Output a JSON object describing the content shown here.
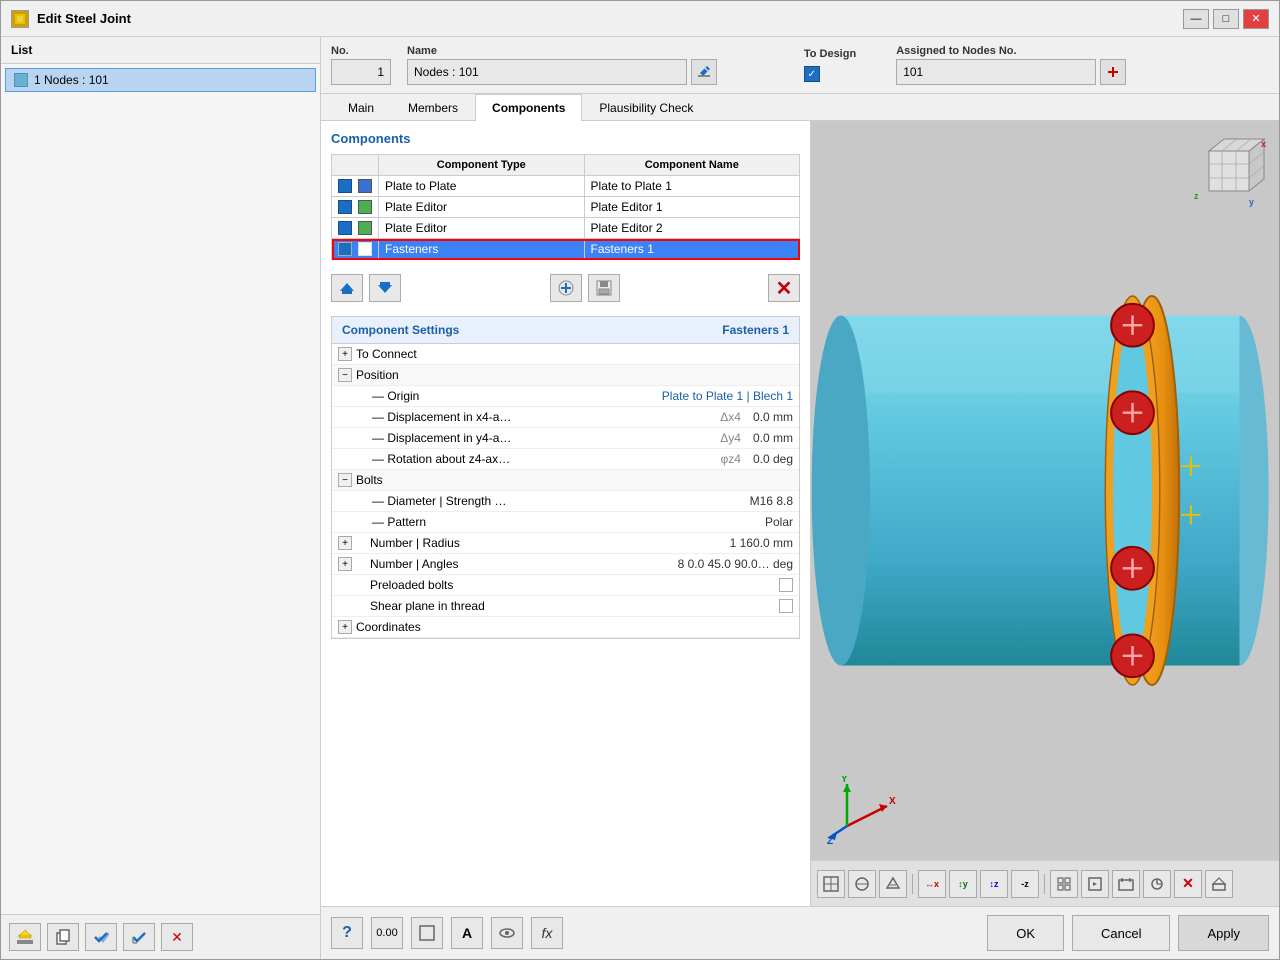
{
  "window": {
    "title": "Edit Steel Joint",
    "icon": "🔧"
  },
  "header": {
    "list_label": "List",
    "no_label": "No.",
    "no_value": "1",
    "name_label": "Name",
    "name_value": "Nodes : 101",
    "to_design_label": "To Design",
    "assigned_label": "Assigned to Nodes No.",
    "assigned_value": "101"
  },
  "tabs": [
    {
      "id": "main",
      "label": "Main",
      "active": false
    },
    {
      "id": "members",
      "label": "Members",
      "active": false
    },
    {
      "id": "components",
      "label": "Components",
      "active": true
    },
    {
      "id": "plausibility",
      "label": "Plausibility Check",
      "active": false
    }
  ],
  "list_items": [
    {
      "label": "1  Nodes : 101"
    }
  ],
  "components": {
    "section_title": "Components",
    "table_headers": [
      "Component Type",
      "Component Name"
    ],
    "rows": [
      {
        "checked": true,
        "color": "blue",
        "type": "Plate to Plate",
        "name": "Plate to Plate 1",
        "selected": false
      },
      {
        "checked": true,
        "color": "green",
        "type": "Plate Editor",
        "name": "Plate Editor 1",
        "selected": false
      },
      {
        "checked": true,
        "color": "green",
        "type": "Plate Editor",
        "name": "Plate Editor 2",
        "selected": false
      },
      {
        "checked": true,
        "color": "white",
        "type": "Fasteners",
        "name": "Fasteners 1",
        "selected": true
      }
    ]
  },
  "component_settings": {
    "title": "Component Settings",
    "subtitle": "Fasteners 1",
    "groups": [
      {
        "id": "to_connect",
        "label": "To Connect",
        "expanded": false
      },
      {
        "id": "position",
        "label": "Position",
        "expanded": true,
        "items": [
          {
            "indent": 1,
            "label": "Origin",
            "symbol": "",
            "value": "Plate to Plate 1 | Blech 1"
          },
          {
            "indent": 1,
            "label": "Displacement in x4-a…",
            "symbol": "Δx4",
            "value": "0.0  mm"
          },
          {
            "indent": 1,
            "label": "Displacement in y4-a…",
            "symbol": "Δy4",
            "value": "0.0  mm"
          },
          {
            "indent": 1,
            "label": "Rotation about z4-ax…",
            "symbol": "φz4",
            "value": "0.0  deg"
          }
        ]
      },
      {
        "id": "bolts",
        "label": "Bolts",
        "expanded": true,
        "items": [
          {
            "indent": 1,
            "label": "Diameter | Strength …",
            "symbol": "",
            "value": "M16   8.8"
          },
          {
            "indent": 1,
            "label": "Pattern",
            "symbol": "",
            "value": "Polar"
          },
          {
            "indent": 1,
            "expander": true,
            "label": "Number | Radius",
            "symbol": "",
            "value": "1       160.0  mm"
          },
          {
            "indent": 1,
            "expander": true,
            "label": "Number | Angles",
            "symbol": "",
            "value": "8   0.0 45.0 90.0…  deg"
          },
          {
            "indent": 1,
            "label": "Preloaded bolts",
            "symbol": "",
            "value": "checkbox"
          },
          {
            "indent": 1,
            "label": "Shear plane in thread",
            "symbol": "",
            "value": "checkbox"
          }
        ]
      },
      {
        "id": "coordinates",
        "label": "Coordinates",
        "expanded": false
      }
    ]
  },
  "actions": {
    "ok_label": "OK",
    "cancel_label": "Cancel",
    "apply_label": "Apply"
  },
  "bottom_icons": [
    "?",
    "0.00",
    "□",
    "A",
    "🔍",
    "fx"
  ]
}
